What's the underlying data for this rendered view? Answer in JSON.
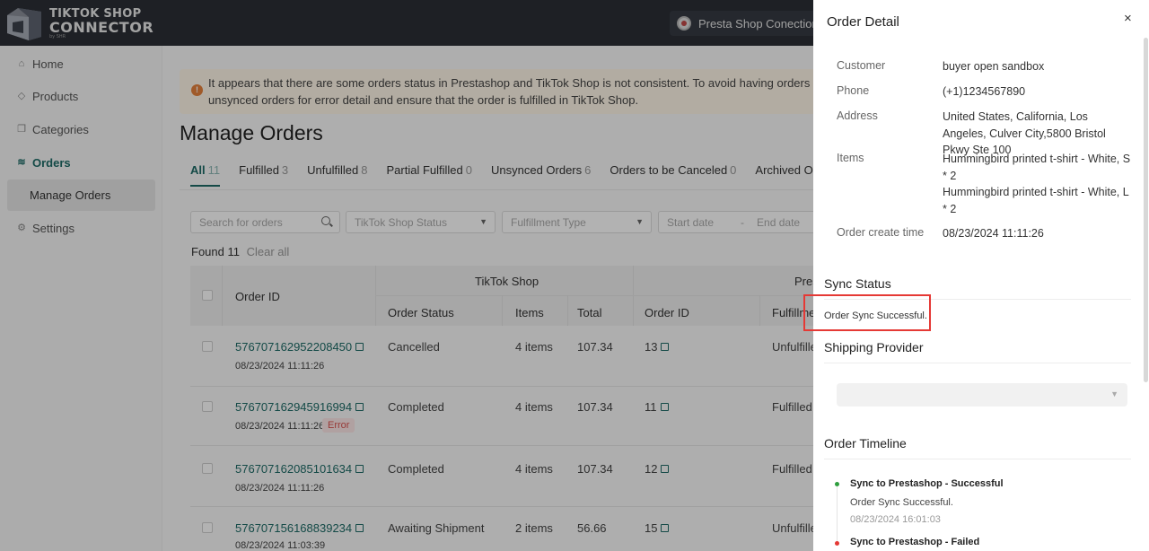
{
  "app": {
    "logo": {
      "line1": "TIKTOK SHOP",
      "line2": "CONNECTOR",
      "line3": "by SHR"
    },
    "connection_button": "Presta Shop Conection"
  },
  "sidebar": {
    "items": [
      {
        "label": "Home",
        "icon": "home-icon"
      },
      {
        "label": "Products",
        "icon": "tag-icon"
      },
      {
        "label": "Categories",
        "icon": "copy-icon"
      },
      {
        "label": "Orders",
        "icon": "layers-icon"
      },
      {
        "label": "Manage Orders"
      },
      {
        "label": "Settings",
        "icon": "gear-icon"
      }
    ],
    "active": "Orders"
  },
  "main": {
    "alert_line1": "It appears that there are some orders status in Prestashop and TikTok Shop is not consistent. To avoid having orders canceled in TikTok Shop, please check",
    "alert_line2": "unsynced orders for error detail and ensure that the order is fulfilled in TikTok Shop.",
    "title": "Manage Orders",
    "tabs": [
      {
        "label": "All",
        "count": "11"
      },
      {
        "label": "Fulfilled",
        "count": "3"
      },
      {
        "label": "Unfulfilled",
        "count": "8"
      },
      {
        "label": "Partial Fulfilled",
        "count": "0"
      },
      {
        "label": "Unsynced Orders",
        "count": "6"
      },
      {
        "label": "Orders to be Canceled",
        "count": "0"
      },
      {
        "label": "Archived Orders",
        "count": ""
      }
    ],
    "filters": {
      "search_placeholder": "Search for orders",
      "status_placeholder": "TikTok Shop Status",
      "fulfillment_placeholder": "Fulfillment Type",
      "start_date": "Start date",
      "date_sep": "-",
      "end_date": "End date"
    },
    "found": "Found 11",
    "clear_all": "Clear all",
    "table": {
      "group_tiktok": "TikTok Shop",
      "group_presta": "Prestashop",
      "headers": {
        "order_id": "Order ID",
        "order_status": "Order Status",
        "items": "Items",
        "total": "Total",
        "presta_order_id": "Order ID",
        "fulfillment": "Fulfillment"
      },
      "rows": [
        {
          "order_id": "576707162952208450",
          "date": "08/23/2024 11:11:26",
          "status": "Cancelled",
          "items": "4 items",
          "total": "107.34",
          "presta_id": "13",
          "fulfillment": "Unfulfilled",
          "badge": ""
        },
        {
          "order_id": "576707162945916994",
          "date": "08/23/2024 11:11:26",
          "status": "Completed",
          "items": "4 items",
          "total": "107.34",
          "presta_id": "11",
          "fulfillment": "Fulfilled",
          "badge": "Error"
        },
        {
          "order_id": "576707162085101634",
          "date": "08/23/2024 11:11:26",
          "status": "Completed",
          "items": "4 items",
          "total": "107.34",
          "presta_id": "12",
          "fulfillment": "Fulfilled",
          "badge": ""
        },
        {
          "order_id": "576707156168839234",
          "date": "08/23/2024 11:03:39",
          "status": "Awaiting Shipment",
          "items": "2 items",
          "total": "56.66",
          "presta_id": "15",
          "fulfillment": "Unfulfilled",
          "badge": ""
        }
      ]
    }
  },
  "drawer": {
    "title": "Order Detail",
    "close": "×",
    "details": {
      "customer_label": "Customer",
      "customer": "buyer open sandbox",
      "phone_label": "Phone",
      "phone": "(+1)1234567890",
      "address_label": "Address",
      "address": "United States, California, Los Angeles, Culver City,5800 Bristol Pkwy Ste 100",
      "items_label": "Items",
      "item1": "Hummingbird printed t-shirt - White, S * 2",
      "item2": "Hummingbird printed t-shirt - White, L * 2",
      "create_label": "Order create time",
      "create_time": "08/23/2024 11:11:26"
    },
    "sync_status_title": "Sync Status",
    "sync_status_text": "Order Sync Successful.",
    "shipping_title": "Shipping Provider",
    "timeline_title": "Order Timeline",
    "timeline": [
      {
        "title": "Sync to Prestashop - Successful",
        "sub": "Order Sync Successful.",
        "time": "08/23/2024 16:01:03",
        "color": "#2e9e3e"
      },
      {
        "title": "Sync to Prestashop - Failed",
        "color": "#e53935"
      }
    ]
  }
}
